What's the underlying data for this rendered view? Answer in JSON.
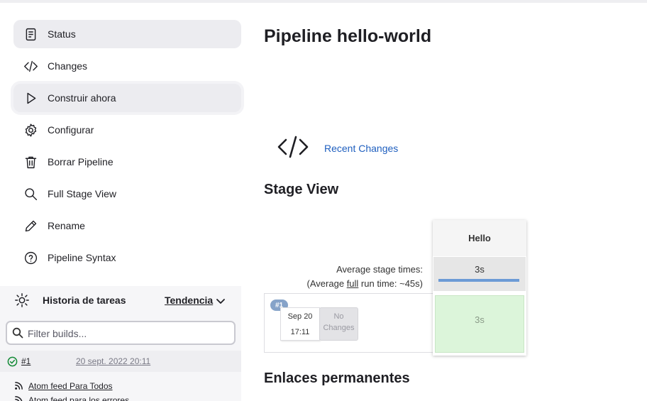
{
  "sidebar": {
    "items": [
      {
        "label": "Status",
        "icon": "document-icon"
      },
      {
        "label": "Changes",
        "icon": "code-icon"
      },
      {
        "label": "Construir ahora",
        "icon": "play-icon"
      },
      {
        "label": "Configurar",
        "icon": "gear-icon"
      },
      {
        "label": "Borrar Pipeline",
        "icon": "trash-icon"
      },
      {
        "label": "Full Stage View",
        "icon": "search-icon"
      },
      {
        "label": "Rename",
        "icon": "pencil-icon"
      },
      {
        "label": "Pipeline Syntax",
        "icon": "help-icon"
      }
    ]
  },
  "history": {
    "title": "Historia de tareas",
    "trend_label": "Tendencia",
    "filter_placeholder": "Filter builds...",
    "builds": [
      {
        "number": "#1",
        "date": "20 sept. 2022 20:11",
        "status": "success"
      }
    ],
    "feeds": [
      "Atom feed Para Todos",
      "Atom feed para los errores"
    ]
  },
  "main": {
    "title": "Pipeline hello-world",
    "recent_changes": "Recent Changes",
    "stage_view_heading": "Stage View",
    "permalinks_heading": "Enlaces permanentes"
  },
  "stage_view": {
    "avg_stage_times": "Average stage times:",
    "avg_full_prefix": "(Average ",
    "avg_full_link": "full",
    "avg_full_suffix": " run time: ~45s)",
    "stage_name": "Hello",
    "stage_avg": "3s",
    "run": {
      "badge": "#1",
      "date": "Sep 20",
      "time": "17:11",
      "no_changes": "No Changes",
      "stage_duration": "3s"
    }
  },
  "colors": {
    "link": "#1f5fbf",
    "success": "#138a36",
    "stage_success_bg": "#dcf5da",
    "avg_bar": "#6c9bd6"
  }
}
